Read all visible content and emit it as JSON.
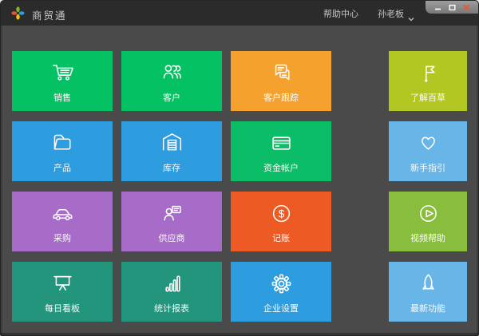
{
  "titlebar": {
    "app_title": "商贸通",
    "help_center": "帮助中心",
    "username": "孙老板"
  },
  "colors": {
    "titlebar_bg": "#2b2b2b",
    "body_bg": "#4a4a4a",
    "green": "#04c263",
    "orange": "#f5a12d",
    "blue": "#2e9de0",
    "purple": "#a76cc8",
    "red_orange": "#ee5a24",
    "teal": "#23957d",
    "yellow_green": "#b3c723",
    "light_blue": "#68b6e8",
    "lime_green": "#89bd3e",
    "close_btn": "#e05a3a"
  },
  "tiles": {
    "main": [
      {
        "name": "sales",
        "label": "销售",
        "icon": "cart-icon",
        "color": "#04c263"
      },
      {
        "name": "customers",
        "label": "客户",
        "icon": "customers-icon",
        "color": "#04c263"
      },
      {
        "name": "customer-follow-up",
        "label": "客户跟踪",
        "icon": "chat-bubbles-icon",
        "color": "#f5a12d"
      },
      {
        "name": "products",
        "label": "产品",
        "icon": "folder-icon",
        "color": "#2e9de0"
      },
      {
        "name": "inventory",
        "label": "库存",
        "icon": "warehouse-icon",
        "color": "#2e9de0"
      },
      {
        "name": "capital-accounts",
        "label": "资金帐户",
        "icon": "bank-card-icon",
        "color": "#0bbd66"
      },
      {
        "name": "purchasing",
        "label": "采购",
        "icon": "car-icon",
        "color": "#a76cc8"
      },
      {
        "name": "suppliers",
        "label": "供应商",
        "icon": "supplier-card-icon",
        "color": "#a76cc8"
      },
      {
        "name": "bookkeeping",
        "label": "记账",
        "icon": "dollar-circle-icon",
        "color": "#ee5a24"
      },
      {
        "name": "daily-board",
        "label": "每日看板",
        "icon": "presentation-board-icon",
        "color": "#23957d"
      },
      {
        "name": "statistics-reports",
        "label": "统计报表",
        "icon": "bar-chart-icon",
        "color": "#23957d"
      },
      {
        "name": "company-settings",
        "label": "企业设置",
        "icon": "gear-icon",
        "color": "#2e9de0"
      }
    ],
    "side": [
      {
        "name": "learn-baicao",
        "label": "了解百草",
        "icon": "flag-icon",
        "color": "#b3c723"
      },
      {
        "name": "beginner-guide",
        "label": "新手指引",
        "icon": "heart-icon",
        "color": "#68b6e8"
      },
      {
        "name": "video-help",
        "label": "视频帮助",
        "icon": "play-circle-icon",
        "color": "#89bd3e"
      },
      {
        "name": "latest-features",
        "label": "最新功能",
        "icon": "rocket-icon",
        "color": "#68b6e8"
      }
    ]
  }
}
